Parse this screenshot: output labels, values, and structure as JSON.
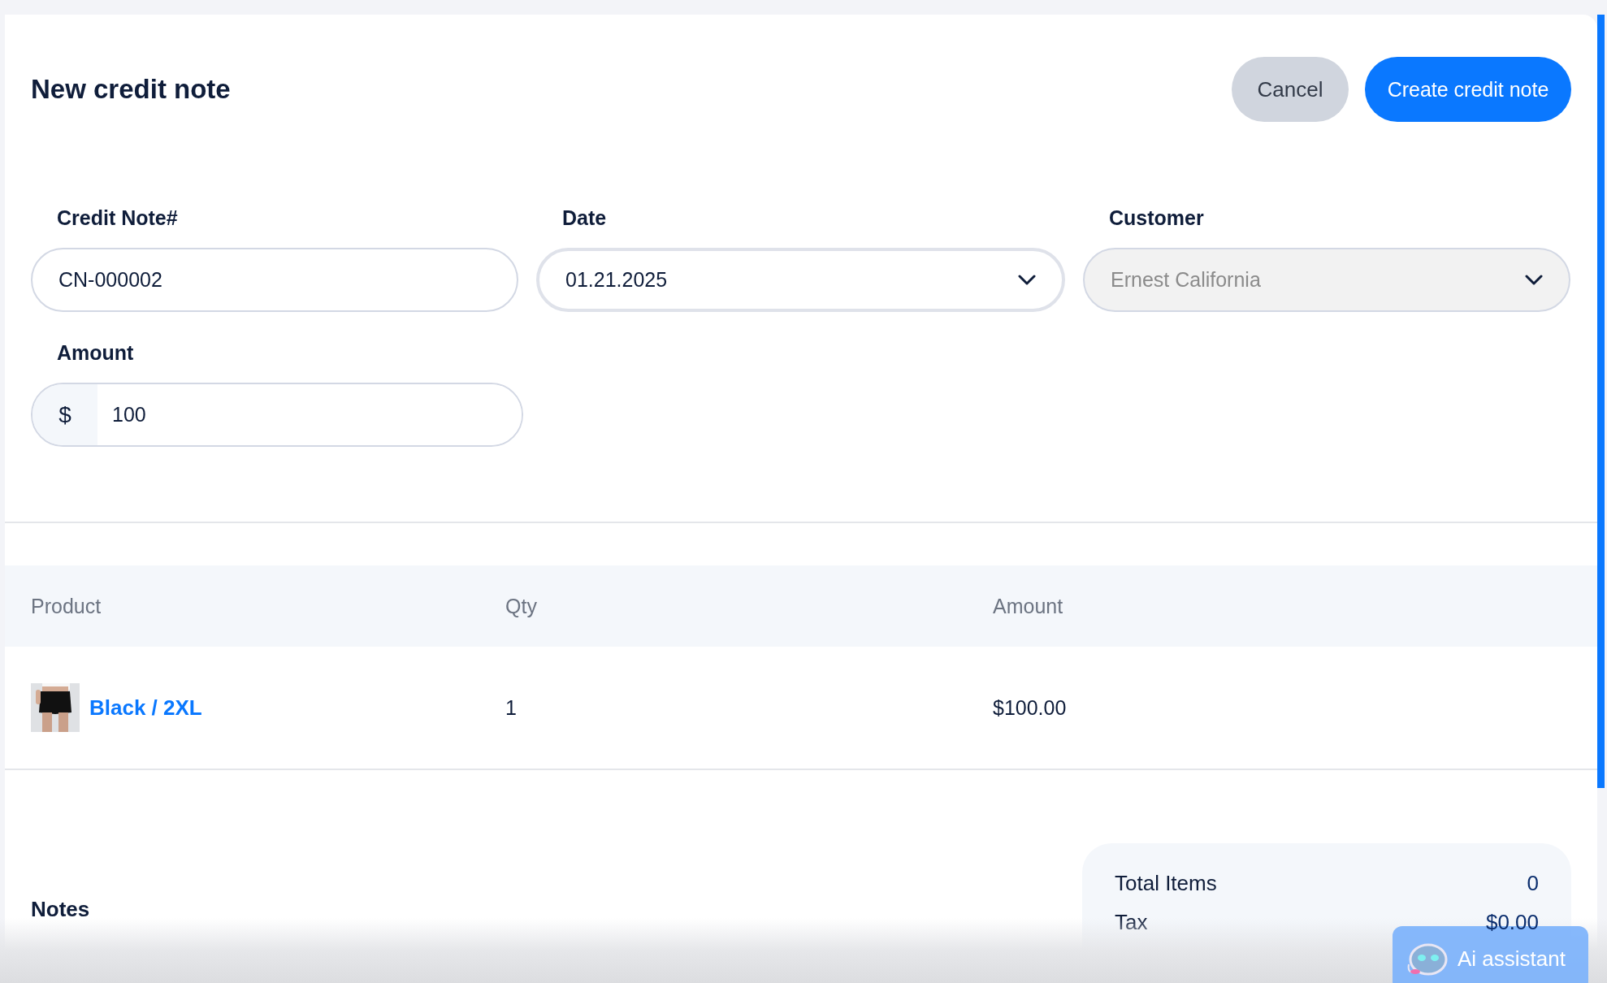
{
  "header": {
    "title": "New credit note",
    "buttons": [
      {
        "label": "Cancel",
        "kind": "secondary"
      },
      {
        "label": "Create credit note",
        "kind": "primary"
      }
    ]
  },
  "fields": [
    {
      "label": "Credit Note#",
      "value": "CN-000002",
      "kind": "text",
      "disabled": false
    },
    {
      "label": "Date",
      "value": "01.21.2025",
      "kind": "select",
      "disabled": false
    },
    {
      "label": "Customer",
      "value": "Ernest California",
      "kind": "select",
      "disabled": true
    },
    {
      "label": "Amount",
      "prefix": "$",
      "value": "100",
      "kind": "money",
      "disabled": false
    }
  ],
  "table": {
    "columns": [
      "Product",
      "Qty",
      "Amount"
    ],
    "rows": [
      {
        "product": {
          "kind": "picture",
          "name": "Black / 2XL"
        },
        "qty": "1",
        "amount": "$100.00"
      }
    ]
  },
  "notes": {
    "label": "Notes"
  },
  "totals": [
    {
      "label": "Total Items",
      "value": "0"
    },
    {
      "label": "Tax",
      "value": "$0.00"
    }
  ],
  "assistant": {
    "label": "Ai assistant"
  }
}
